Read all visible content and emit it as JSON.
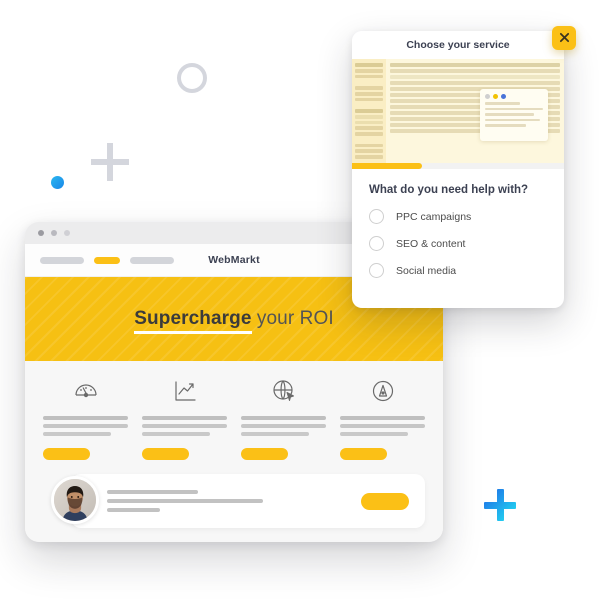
{
  "decorations": {
    "ring": "ring-outline",
    "plus_grey": "plus-shape",
    "dot_blue": "dot-shape",
    "plus_blue": "plus-shape",
    "colors": {
      "grey": "#d4d6dd",
      "blue_dot": "#1a86e8",
      "blue_plus_start": "#1f7fe8",
      "blue_plus_end": "#22cdf0"
    }
  },
  "browser": {
    "titlebar": {
      "dots": [
        "window-dot",
        "window-dot",
        "window-dot"
      ]
    },
    "nav": {
      "brand": "WebMarkt",
      "left_pills": [
        "nav-pill",
        "nav-pill-active",
        "nav-pill"
      ],
      "right_pills": [
        "nav-pill",
        "nav-pill"
      ]
    },
    "hero": {
      "title_strong": "Supercharge",
      "title_light": " your ROI",
      "background_color": "#f6c013",
      "underline_color": "#ffffff"
    },
    "features": [
      {
        "icon": "gauge-icon",
        "button_label": ""
      },
      {
        "icon": "line-chart-icon",
        "button_label": ""
      },
      {
        "icon": "globe-cursor-icon",
        "button_label": ""
      },
      {
        "icon": "pen-nib-circle-icon",
        "button_label": ""
      }
    ],
    "testimonial": {
      "avatar": "user-avatar-photo",
      "button_label": ""
    },
    "accent_color": "#fbc016"
  },
  "dialog": {
    "title": "Choose your service",
    "close_label": "×",
    "progress_percent": 33,
    "preview": {
      "alt": "email-list-preview"
    },
    "question": "What do you need help with?",
    "options": [
      {
        "label": "PPC campaigns",
        "selected": false
      },
      {
        "label": "SEO & content",
        "selected": false
      },
      {
        "label": "Social media",
        "selected": false
      }
    ]
  }
}
